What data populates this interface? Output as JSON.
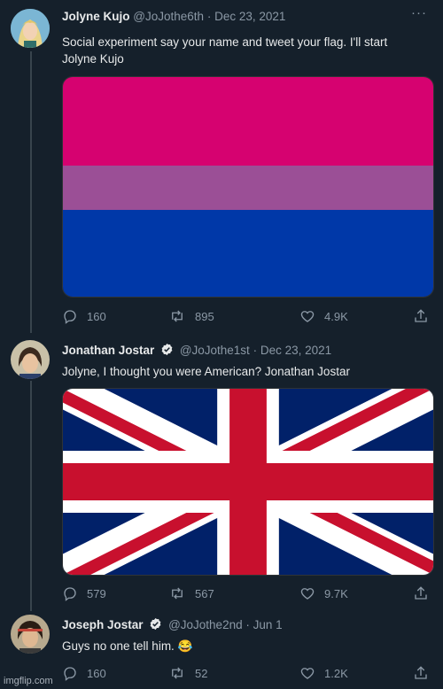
{
  "tweets": [
    {
      "name": "Jolyne Kujo",
      "handle": "@JoJothe6th",
      "date": "Dec 23, 2021",
      "verified": false,
      "text_line1": "Social experiment  say your name and tweet your flag. I'll start",
      "text_line2": "Jolyne Kujo",
      "media": "bisexual-flag",
      "replies": "160",
      "retweets": "895",
      "likes": "4.9K",
      "colors": {
        "top": "#d60270",
        "middle": "#9b4f96",
        "bottom": "#0038a8"
      }
    },
    {
      "name": "Jonathan Jostar",
      "handle": "@JoJothe1st",
      "date": "Dec 23, 2021",
      "verified": true,
      "text_line1": "Jolyne, I thought you were American?  Jonathan Jostar",
      "media": "union-jack",
      "replies": "579",
      "retweets": "567",
      "likes": "9.7K",
      "colors": {
        "blue": "#012169",
        "red": "#c8102e",
        "white": "#ffffff"
      }
    },
    {
      "name": "Joseph Jostar",
      "handle": "@JoJothe2nd",
      "date": "Jun 1",
      "verified": true,
      "text_line1": "Guys no one tell him. 😂",
      "replies": "160",
      "retweets": "52",
      "likes": "1.2K"
    }
  ],
  "separator": "·",
  "more_icon": "···",
  "watermark": "imgflip.com",
  "theme": {
    "background": "#15202b",
    "muted": "#8b98a5",
    "verified": "#1d9bf0",
    "line": "#38444d"
  }
}
